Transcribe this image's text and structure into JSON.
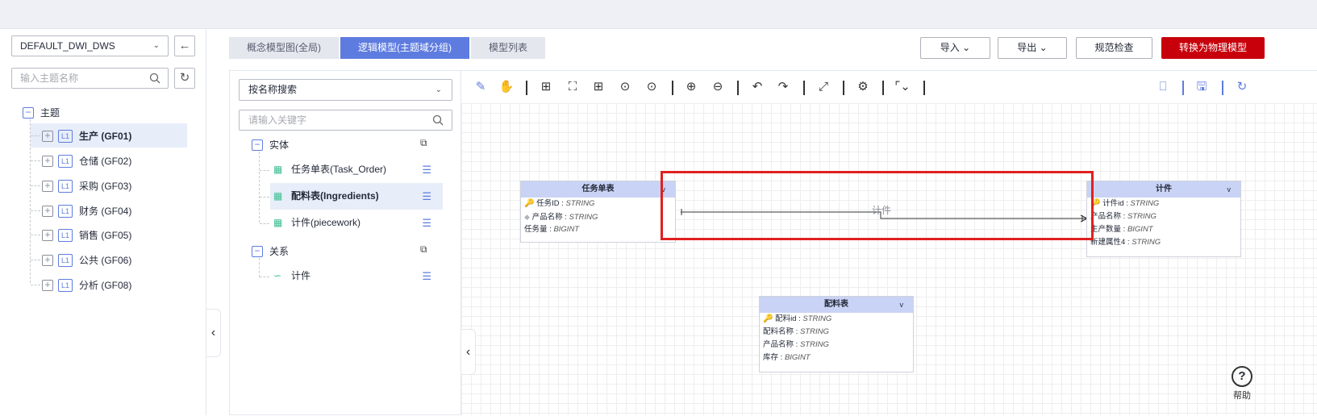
{
  "workspace": {
    "selected": "DEFAULT_DWI_DWS"
  },
  "left_search": {
    "placeholder": "输入主题名称"
  },
  "subject_tree": {
    "root_label": "主题",
    "badge": "L1",
    "items": [
      {
        "label": "生产 (GF01)",
        "selected": true
      },
      {
        "label": "仓储 (GF02)",
        "selected": false
      },
      {
        "label": "采购 (GF03)",
        "selected": false
      },
      {
        "label": "财务 (GF04)",
        "selected": false
      },
      {
        "label": "销售 (GF05)",
        "selected": false
      },
      {
        "label": "公共 (GF06)",
        "selected": false
      },
      {
        "label": "分析 (GF08)",
        "selected": false
      }
    ]
  },
  "tabs": [
    {
      "label": "概念模型图(全局)",
      "active": false
    },
    {
      "label": "逻辑模型(主题域分组)",
      "active": true
    },
    {
      "label": "模型列表",
      "active": false
    }
  ],
  "header_buttons": {
    "import": "导入",
    "export": "导出",
    "check": "规范检查",
    "convert": "转换为物理模型"
  },
  "model_panel": {
    "search_mode": "按名称搜索",
    "keyword_placeholder": "请输入关键字",
    "entity_group": "实体",
    "entities": [
      {
        "label": "任务单表(Task_Order)",
        "selected": false
      },
      {
        "label": "配料表(Ingredients)",
        "selected": true
      },
      {
        "label": "计件(piecework)",
        "selected": false
      }
    ],
    "relation_group": "关系",
    "relations": [
      {
        "label": "计件"
      }
    ]
  },
  "diagram": {
    "entities": [
      {
        "title": "任务单表",
        "rows": [
          {
            "name": "任务ID",
            "type": "STRING",
            "pk": true
          },
          {
            "name": "产品名称",
            "type": "STRING",
            "fk": true
          },
          {
            "name": "任务量",
            "type": "BIGINT"
          }
        ]
      },
      {
        "title": "计件",
        "rows": [
          {
            "name": "计件id",
            "type": "STRING",
            "pk": true
          },
          {
            "name": "产品名称",
            "type": "STRING"
          },
          {
            "name": "生产数量",
            "type": "BIGINT"
          },
          {
            "name": "新建属性4",
            "type": "STRING"
          }
        ]
      },
      {
        "title": "配料表",
        "rows": [
          {
            "name": "配料id",
            "type": "STRING",
            "pk": true
          },
          {
            "name": "配料名称",
            "type": "STRING"
          },
          {
            "name": "产品名称",
            "type": "STRING"
          },
          {
            "name": "库存",
            "type": "BIGINT"
          }
        ]
      }
    ],
    "relation_label": "计件",
    "chevron": "v"
  },
  "help": {
    "label": "帮助",
    "symbol": "?"
  },
  "colors": {
    "primary": "#5e7ce0",
    "danger": "#c7000b",
    "entity_header": "#c9d3f5",
    "highlight_box": "#e02020"
  }
}
